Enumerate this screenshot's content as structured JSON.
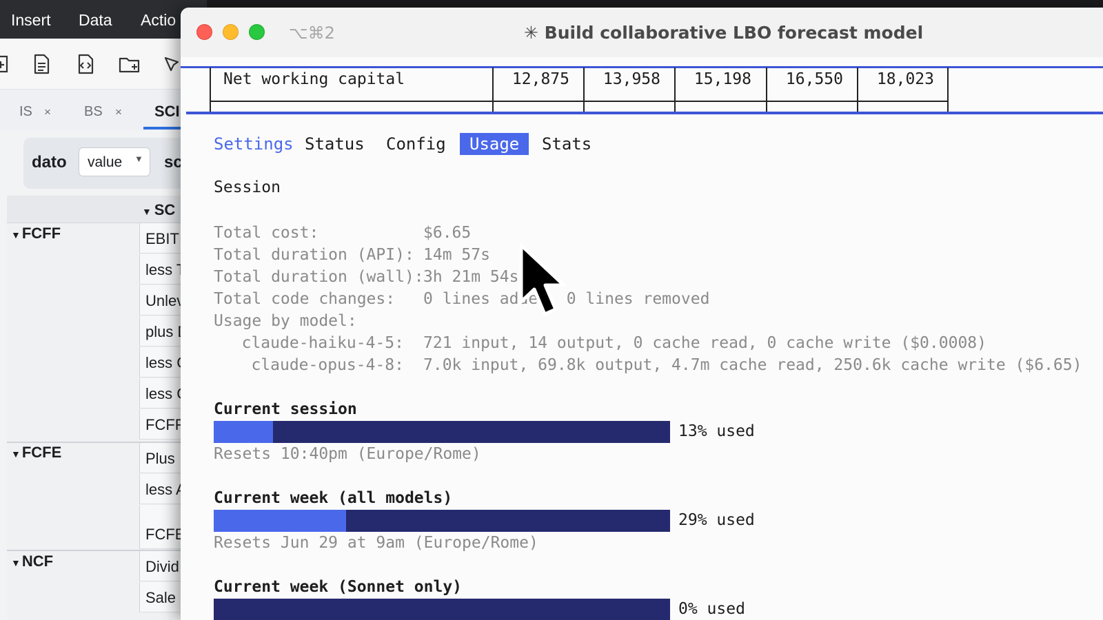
{
  "background_app": {
    "menu": [
      "Insert",
      "Data",
      "Actio"
    ],
    "tabs": [
      {
        "label": "IS",
        "close": "×"
      },
      {
        "label": "BS",
        "close": "×"
      },
      {
        "label": "SCI"
      }
    ],
    "filter": {
      "label": "dato",
      "select_value": "value",
      "extra": "sc"
    },
    "grid_header": "SC",
    "groups": [
      {
        "name": "FCFF",
        "rows": [
          "EBIT",
          "less T",
          "Unlev",
          "plus D",
          "less C",
          "less C",
          "FCFF"
        ]
      },
      {
        "name": "FCFE",
        "rows": [
          "Plus",
          "less A",
          "",
          "FCFE"
        ]
      },
      {
        "name": "NCF",
        "rows": [
          "Divid",
          "Sale"
        ]
      }
    ]
  },
  "window": {
    "shortcut": "⌥⌘2",
    "title": "✳ Build collaborative LBO forecast model"
  },
  "table": {
    "label": "Net working capital",
    "values": [
      "12,875",
      "13,958",
      "15,198",
      "16,550",
      "18,023"
    ]
  },
  "tabs": [
    "Settings",
    "Status",
    "Config",
    "Usage",
    "Stats"
  ],
  "active_tab": "Usage",
  "session": {
    "heading": "Session",
    "stats": [
      {
        "label": "Total cost:",
        "value": "$6.65"
      },
      {
        "label": "Total duration (API):",
        "value": "14m 57s"
      },
      {
        "label": "Total duration (wall):",
        "value": "3h 21m 54s"
      },
      {
        "label": "Total code changes:",
        "value": "0 lines added, 0 lines removed"
      }
    ],
    "usage_label": "Usage by model:",
    "models": [
      {
        "name": "claude-haiku-4-5:",
        "usage": "721 input, 14 output, 0 cache read, 0 cache write ($0.0008)"
      },
      {
        "name": "claude-opus-4-8:",
        "usage": "7.0k input, 69.8k output, 4.7m cache read, 250.6k cache write ($6.65)"
      }
    ]
  },
  "limits": [
    {
      "title": "Current session",
      "percent": 13,
      "percent_label": "13% used",
      "reset": "Resets 10:40pm (Europe/Rome)"
    },
    {
      "title": "Current week (all models)",
      "percent": 29,
      "percent_label": "29% used",
      "reset": "Resets Jun 29 at 9am (Europe/Rome)"
    },
    {
      "title": "Current week (Sonnet only)",
      "percent": 0,
      "percent_label": "0% used",
      "reset": ""
    }
  ],
  "colors": {
    "accent": "#4a68ea",
    "bar_track": "#252a6e",
    "muted_text": "#8a8a8a",
    "traffic_close": "#fe5f57",
    "traffic_min": "#febc2e",
    "traffic_max": "#28c840"
  },
  "icons": [
    "add-row-icon",
    "document-icon",
    "code-file-icon",
    "folder-add-icon",
    "pen-icon",
    "mouse-cursor-icon"
  ]
}
